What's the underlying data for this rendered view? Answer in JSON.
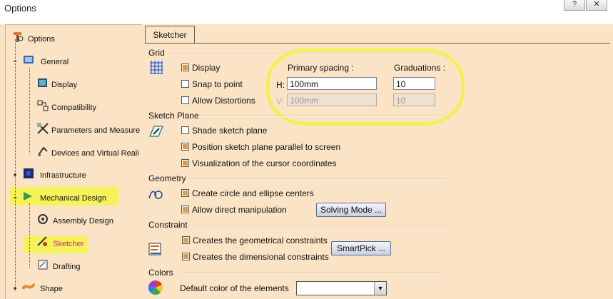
{
  "window": {
    "title": "Options",
    "help_label": "?",
    "close_label": "✕"
  },
  "tree": {
    "root": "Options",
    "general": "General",
    "display": "Display",
    "compatibility": "Compatibility",
    "parameters": "Parameters and Measure",
    "devices": "Devices and Virtual Reali",
    "infrastructure": "Infrastructure",
    "mechanical": "Mechanical Design",
    "assembly": "Assembly Design",
    "sketcher": "Sketcher",
    "drafting": "Drafting",
    "shape": "Shape"
  },
  "tab": {
    "label": "Sketcher"
  },
  "grid": {
    "title": "Grid",
    "display": "Display",
    "snap": "Snap to point",
    "distortions": "Allow Distortions",
    "primary_label": "Primary spacing :",
    "grad_label": "Graduations :",
    "h_label": "H:",
    "v_label": "V:",
    "h_value": "100mm",
    "v_value": "100mm",
    "h_grad": "10",
    "v_grad": "10"
  },
  "plane": {
    "title": "Sketch Plane",
    "shade": "Shade sketch plane",
    "position": "Position sketch plane parallel to screen",
    "visual": "Visualization of the cursor coordinates"
  },
  "geometry": {
    "title": "Geometry",
    "centers": "Create circle and ellipse centers",
    "direct": "Allow direct manipulation",
    "solving_btn": "Solving Mode ..."
  },
  "constraint": {
    "title": "Constraint",
    "geo": "Creates the geometrical constraints",
    "dim": "Creates the dimensional constraints",
    "smartpick_btn": "SmartPick ..."
  },
  "colors": {
    "title": "Colors",
    "default_label": "Default color of the elements"
  },
  "accent": {
    "highlight": "#f6f35a",
    "checkbox": "#e39a3a"
  }
}
